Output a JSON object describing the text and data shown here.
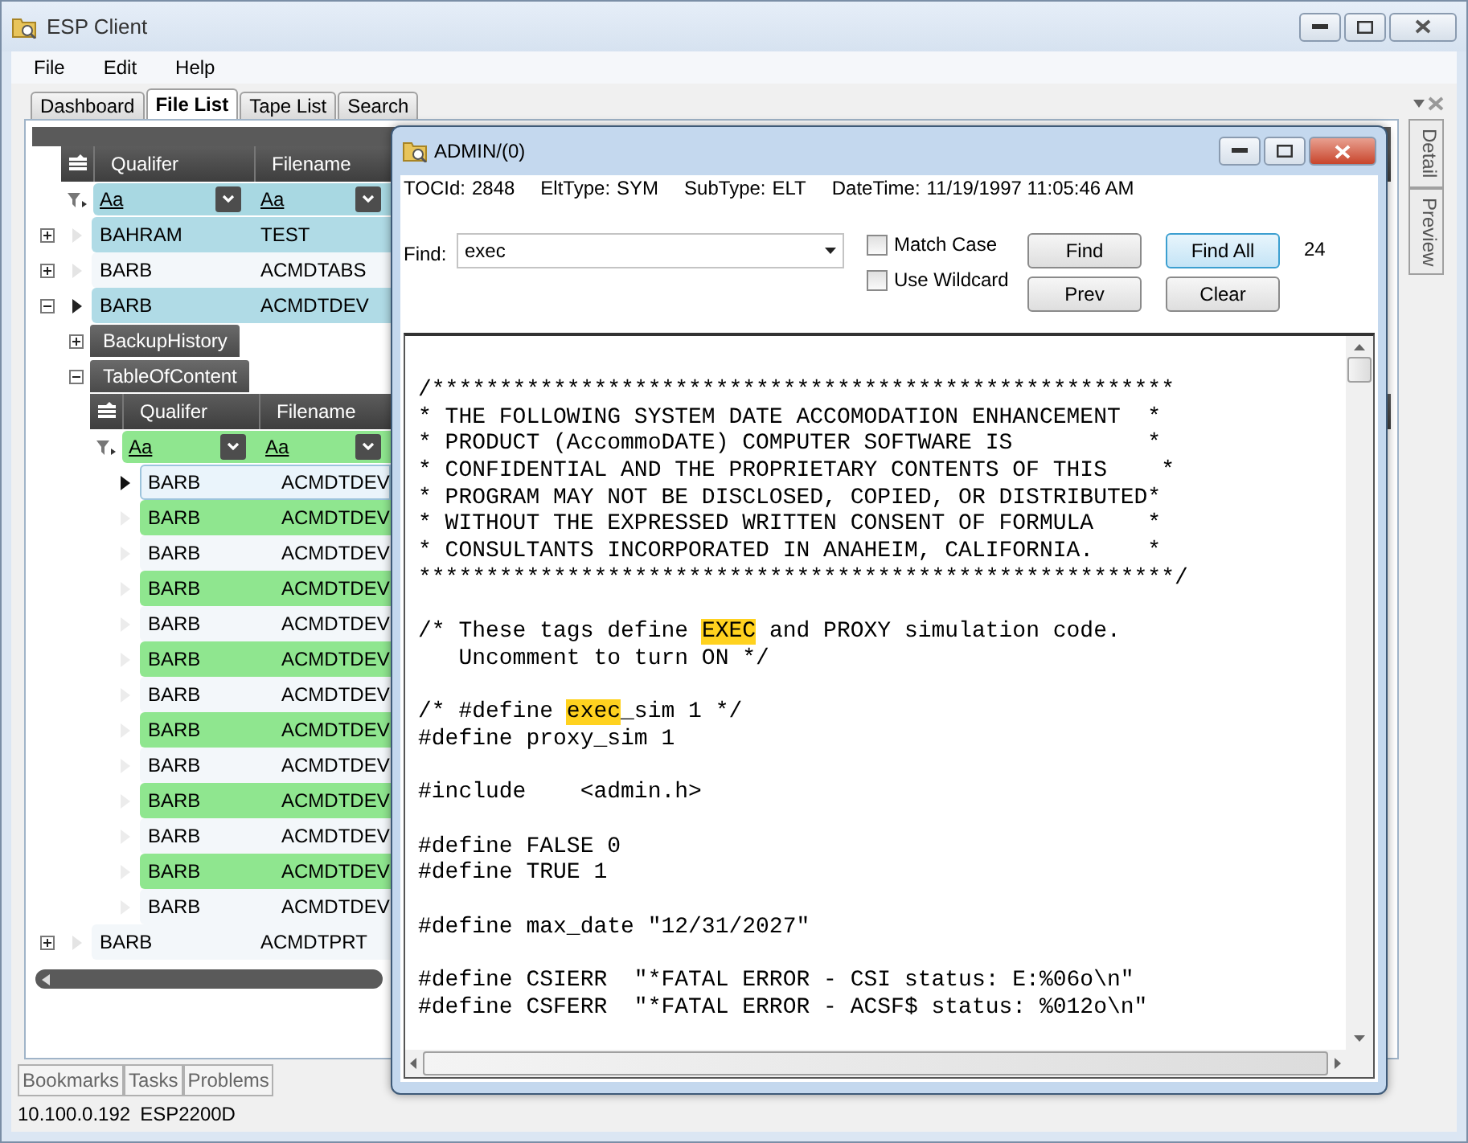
{
  "window": {
    "title": "ESP Client"
  },
  "menu": [
    "File",
    "Edit",
    "Help"
  ],
  "tabs": [
    {
      "label": "Dashboard",
      "selected": false
    },
    {
      "label": "File List",
      "selected": true
    },
    {
      "label": "Tape List",
      "selected": false
    },
    {
      "label": "Search",
      "selected": false
    }
  ],
  "side_tabs": [
    "Detail",
    "Preview"
  ],
  "grid": {
    "columns": [
      "Qualifer",
      "Filename"
    ],
    "filters": [
      "Aa",
      "Aa"
    ],
    "rows": [
      {
        "qualifier": "BAHRAM",
        "filename": "TEST",
        "expanded": false,
        "highlighted": true
      },
      {
        "qualifier": "BARB",
        "filename": "ACMDTABS",
        "expanded": false,
        "highlighted": false
      },
      {
        "qualifier": "BARB",
        "filename": "ACMDTDEV",
        "expanded": true,
        "highlighted": true,
        "sections": [
          {
            "label": "BackupHistory",
            "expanded": false
          },
          {
            "label": "TableOfContent",
            "expanded": true
          }
        ],
        "child_grid": {
          "columns": [
            "Qualifer",
            "Filename"
          ],
          "filters": [
            "Aa",
            "Aa"
          ],
          "rows": [
            {
              "qualifier": "BARB",
              "filename": "ACMDTDEV",
              "selected": true,
              "highlighted": false
            },
            {
              "qualifier": "BARB",
              "filename": "ACMDTDEV",
              "selected": false,
              "highlighted": true
            },
            {
              "qualifier": "BARB",
              "filename": "ACMDTDEV",
              "selected": false,
              "highlighted": false
            },
            {
              "qualifier": "BARB",
              "filename": "ACMDTDEV",
              "selected": false,
              "highlighted": true
            },
            {
              "qualifier": "BARB",
              "filename": "ACMDTDEV",
              "selected": false,
              "highlighted": false
            },
            {
              "qualifier": "BARB",
              "filename": "ACMDTDEV",
              "selected": false,
              "highlighted": true
            },
            {
              "qualifier": "BARB",
              "filename": "ACMDTDEV",
              "selected": false,
              "highlighted": false
            },
            {
              "qualifier": "BARB",
              "filename": "ACMDTDEV",
              "selected": false,
              "highlighted": true
            },
            {
              "qualifier": "BARB",
              "filename": "ACMDTDEV",
              "selected": false,
              "highlighted": false
            },
            {
              "qualifier": "BARB",
              "filename": "ACMDTDEV",
              "selected": false,
              "highlighted": true
            },
            {
              "qualifier": "BARB",
              "filename": "ACMDTDEV",
              "selected": false,
              "highlighted": false
            },
            {
              "qualifier": "BARB",
              "filename": "ACMDTDEV",
              "selected": false,
              "highlighted": true
            },
            {
              "qualifier": "BARB",
              "filename": "ACMDTDEV",
              "selected": false,
              "highlighted": false
            }
          ]
        }
      },
      {
        "qualifier": "BARB",
        "filename": "ACMDTPRT",
        "expanded": false,
        "highlighted": false
      }
    ]
  },
  "bottom_tabs": [
    "Bookmarks",
    "Tasks",
    "Problems"
  ],
  "status_bar": [
    "10.100.0.192",
    "ESP2200D"
  ],
  "dialog": {
    "title": "ADMIN/(0)",
    "info": [
      {
        "label": "TOCId:",
        "value": "2848"
      },
      {
        "label": "EltType:",
        "value": "SYM"
      },
      {
        "label": "SubType:",
        "value": "ELT"
      },
      {
        "label": "DateTime:",
        "value": "11/19/1997 11:05:46 AM"
      }
    ],
    "find": {
      "label": "Find:",
      "value": "exec"
    },
    "options": [
      {
        "label": "Match Case",
        "checked": false
      },
      {
        "label": "Use Wildcard",
        "checked": false
      }
    ],
    "buttons": [
      {
        "label": "Find",
        "default": false
      },
      {
        "label": "Find All",
        "default": true
      },
      {
        "label": "Prev",
        "default": false
      },
      {
        "label": "Clear",
        "default": false
      }
    ],
    "match_count": "24",
    "code": [
      {
        "kind": "plain",
        "text": "/*******************************************************"
      },
      {
        "kind": "plain",
        "text": "* THE FOLLOWING SYSTEM DATE ACCOMODATION ENHANCEMENT  *"
      },
      {
        "kind": "plain",
        "text": "* PRODUCT (AccommoDATE) COMPUTER SOFTWARE IS          *"
      },
      {
        "kind": "plain",
        "text": "* CONFIDENTIAL AND THE PROPRIETARY CONTENTS OF THIS    *"
      },
      {
        "kind": "plain",
        "text": "* PROGRAM MAY NOT BE DISCLOSED, COPIED, OR DISTRIBUTED*"
      },
      {
        "kind": "plain",
        "text": "* WITHOUT THE EXPRESSED WRITTEN CONSENT OF FORMULA    *"
      },
      {
        "kind": "plain",
        "text": "* CONSULTANTS INCORPORATED IN ANAHEIM, CALIFORNIA.    *"
      },
      {
        "kind": "plain",
        "text": "********************************************************/"
      },
      {
        "kind": "blank"
      },
      {
        "kind": "found",
        "parts": [
          {
            "text": "/* These tags define ",
            "match": false
          },
          {
            "text": "EXEC",
            "match": true
          },
          {
            "text": " and PROXY simulation code.",
            "match": false
          }
        ]
      },
      {
        "kind": "plain",
        "text": "   Uncomment to turn ON */"
      },
      {
        "kind": "blank"
      },
      {
        "kind": "found",
        "parts": [
          {
            "text": "/* #define ",
            "match": false
          },
          {
            "text": "exec",
            "match": true
          },
          {
            "text": "_sim 1 */",
            "match": false
          }
        ]
      },
      {
        "kind": "plain",
        "text": "#define proxy_sim 1"
      },
      {
        "kind": "blank"
      },
      {
        "kind": "plain",
        "text": "#include    <admin.h>"
      },
      {
        "kind": "blank"
      },
      {
        "kind": "plain",
        "text": "#define FALSE 0"
      },
      {
        "kind": "plain",
        "text": "#define TRUE 1"
      },
      {
        "kind": "blank"
      },
      {
        "kind": "plain",
        "text": "#define max_date \"12/31/2027\""
      },
      {
        "kind": "blank"
      },
      {
        "kind": "plain",
        "text": "#define CSIERR  \"*FATAL ERROR - CSI status: E:%06o\\n\""
      },
      {
        "kind": "plain",
        "text": "#define CSFERR  \"*FATAL ERROR - ACSF$ status: %012o\\n\""
      }
    ]
  }
}
